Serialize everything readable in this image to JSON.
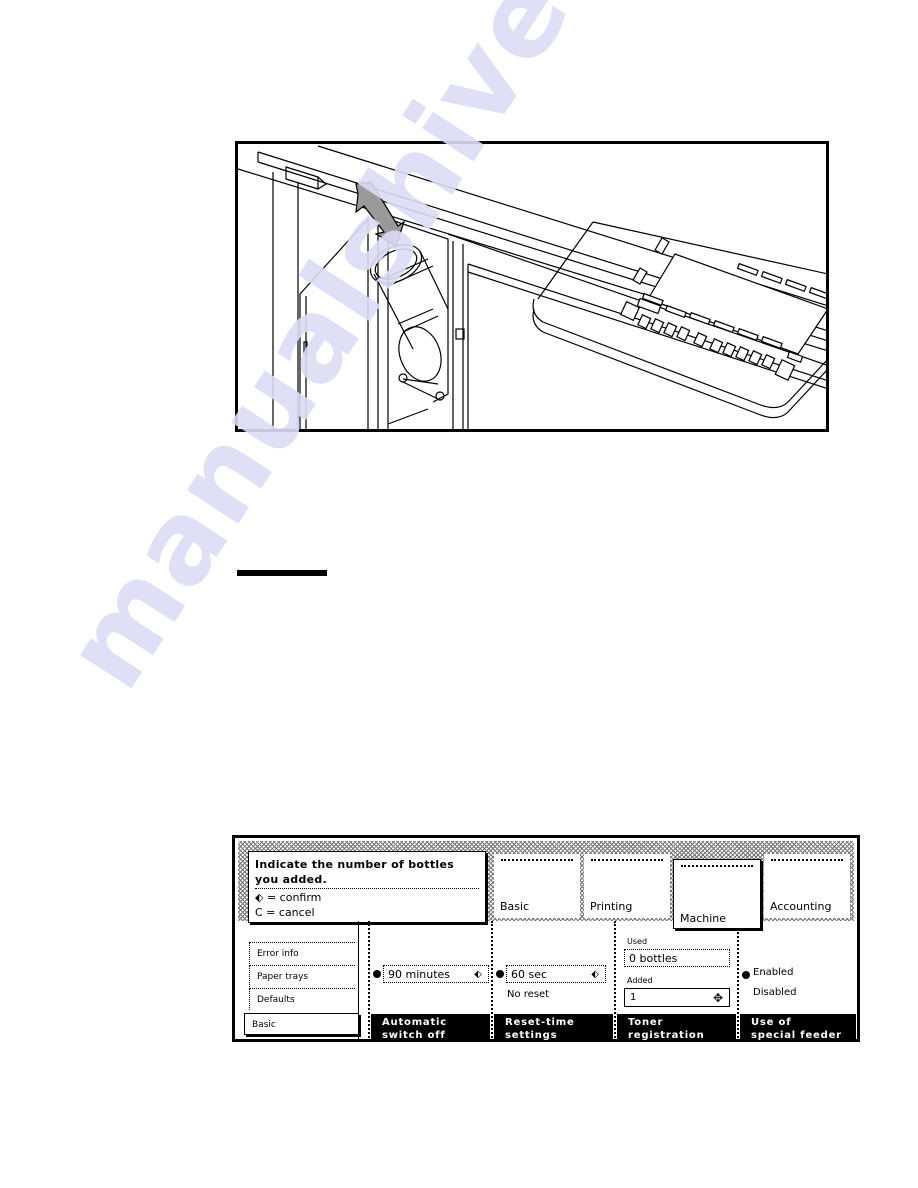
{
  "figure": {
    "description": "Illustration: inserting a toner bottle into the copier, arrow pointing down at the bottle; control panel on the right"
  },
  "watermark": "manualshive.com",
  "panel": {
    "message": {
      "title": "Indicate the number of bottles you added.",
      "confirm_line": "⬖ = confirm",
      "cancel_line": "C = cancel"
    },
    "tabs": [
      {
        "label": "Basic",
        "active": false
      },
      {
        "label": "Printing",
        "active": false
      },
      {
        "label": "Machine",
        "active": true
      },
      {
        "label": "Accounting",
        "active": false
      }
    ],
    "left_nav": {
      "items": [
        "Error info",
        "Paper trays",
        "Defaults"
      ],
      "selected": "Basic"
    },
    "columns": [
      {
        "heading": "Automatic switch off",
        "heading_l1": "Automatic",
        "heading_l2": "switch off",
        "value": "90 minutes",
        "icon": "spin-arrows-icon"
      },
      {
        "heading": "Reset-time settings",
        "heading_l1": "Reset-time",
        "heading_l2": "settings",
        "value": "60 sec",
        "alt_option": "No reset",
        "icon": "spin-arrows-icon"
      },
      {
        "heading": "Toner registration",
        "heading_l1": "Toner",
        "heading_l2": "registration",
        "used_label": "Used",
        "used_value": "0 bottles",
        "added_label": "Added",
        "added_value": "1",
        "icon": "four-way-arrows-icon"
      },
      {
        "heading": "Use of special feeder",
        "heading_l1": "Use of",
        "heading_l2": "special feeder",
        "options": [
          "Enabled",
          "Disabled"
        ],
        "selected": "Enabled"
      }
    ]
  }
}
